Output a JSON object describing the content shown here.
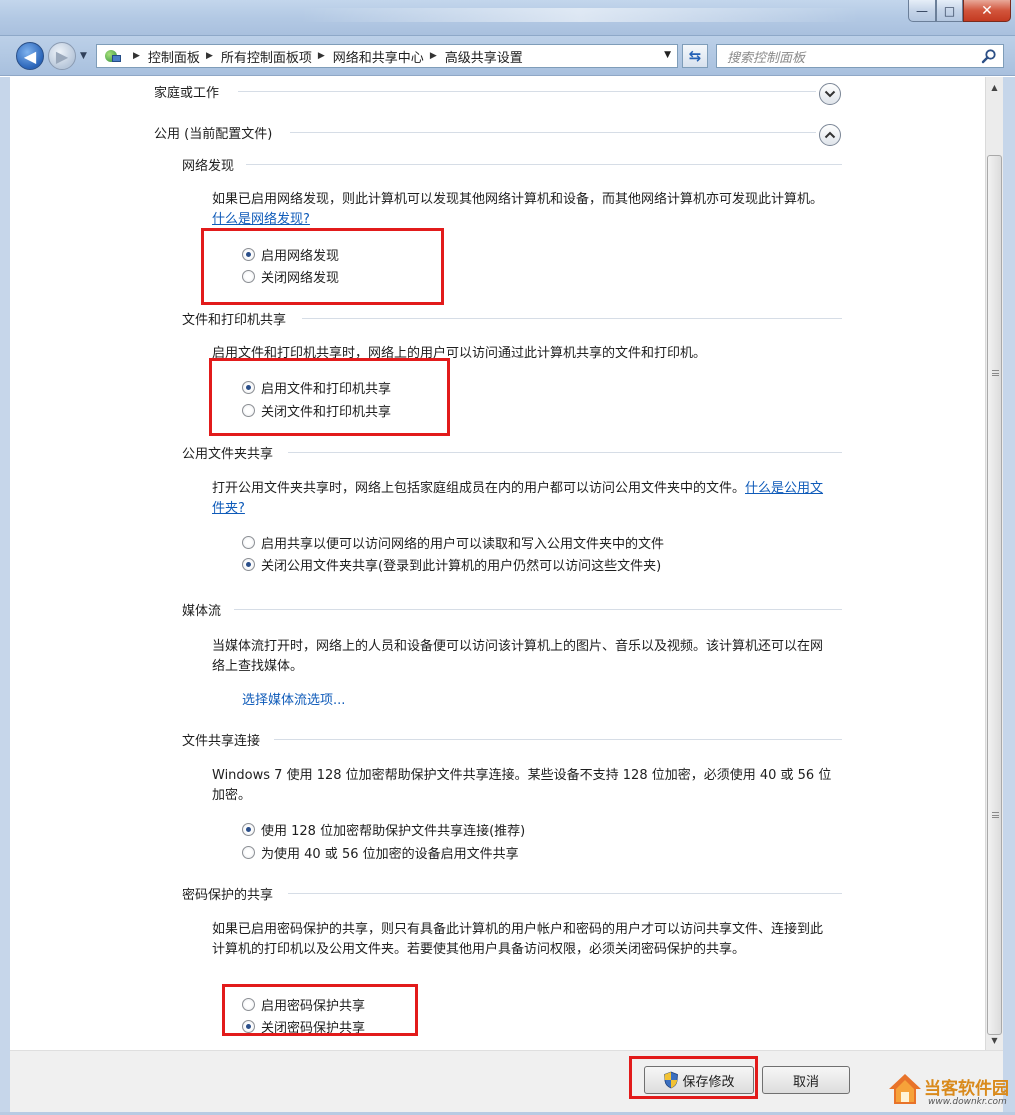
{
  "window": {
    "controls": {
      "minimize": "—",
      "maximize": "□",
      "close": "✕"
    }
  },
  "address_bar": {
    "breadcrumbs": [
      "控制面板",
      "所有控制面板项",
      "网络和共享中心",
      "高级共享设置"
    ]
  },
  "search": {
    "placeholder": "搜索控制面板"
  },
  "groups": {
    "home_work": {
      "title": "家庭或工作"
    },
    "public": {
      "title": "公用 (当前配置文件)"
    }
  },
  "sections": {
    "network_discovery": {
      "title": "网络发现",
      "desc": "如果已启用网络发现，则此计算机可以发现其他网络计算机和设备，而其他网络计算机亦可发现此计算机。",
      "link": "什么是网络发现?",
      "options": [
        {
          "label": "启用网络发现",
          "checked": true
        },
        {
          "label": "关闭网络发现",
          "checked": false
        }
      ]
    },
    "file_printer": {
      "title": "文件和打印机共享",
      "desc": "启用文件和打印机共享时，网络上的用户可以访问通过此计算机共享的文件和打印机。",
      "options": [
        {
          "label": "启用文件和打印机共享",
          "checked": true
        },
        {
          "label": "关闭文件和打印机共享",
          "checked": false
        }
      ]
    },
    "public_folder": {
      "title": "公用文件夹共享",
      "desc": "打开公用文件夹共享时，网络上包括家庭组成员在内的用户都可以访问公用文件夹中的文件。",
      "link": "什么是公用文件夹?",
      "options": [
        {
          "label": "启用共享以便可以访问网络的用户可以读取和写入公用文件夹中的文件",
          "checked": false
        },
        {
          "label": "关闭公用文件夹共享(登录到此计算机的用户仍然可以访问这些文件夹)",
          "checked": true
        }
      ]
    },
    "media_streaming": {
      "title": "媒体流",
      "desc": "当媒体流打开时，网络上的人员和设备便可以访问该计算机上的图片、音乐以及视频。该计算机还可以在网络上查找媒体。",
      "link": "选择媒体流选项..."
    },
    "file_sharing_connections": {
      "title": "文件共享连接",
      "desc": "Windows 7 使用 128 位加密帮助保护文件共享连接。某些设备不支持 128 位加密，必须使用 40 或 56 位加密。",
      "options": [
        {
          "label": "使用 128 位加密帮助保护文件共享连接(推荐)",
          "checked": true
        },
        {
          "label": "为使用 40 或 56 位加密的设备启用文件共享",
          "checked": false
        }
      ]
    },
    "password_protected": {
      "title": "密码保护的共享",
      "desc": "如果已启用密码保护的共享，则只有具备此计算机的用户帐户和密码的用户才可以访问共享文件、连接到此计算机的打印机以及公用文件夹。若要使其他用户具备访问权限，必须关闭密码保护的共享。",
      "options": [
        {
          "label": "启用密码保护共享",
          "checked": false
        },
        {
          "label": "关闭密码保护共享",
          "checked": true
        }
      ]
    }
  },
  "footer": {
    "save_label": "保存修改",
    "cancel_label": "取消"
  },
  "watermark": {
    "text": "当客软件园",
    "url": "www.downkr.com"
  },
  "colors": {
    "link": "#0f5bb9",
    "highlight_box": "#e21b1b"
  }
}
